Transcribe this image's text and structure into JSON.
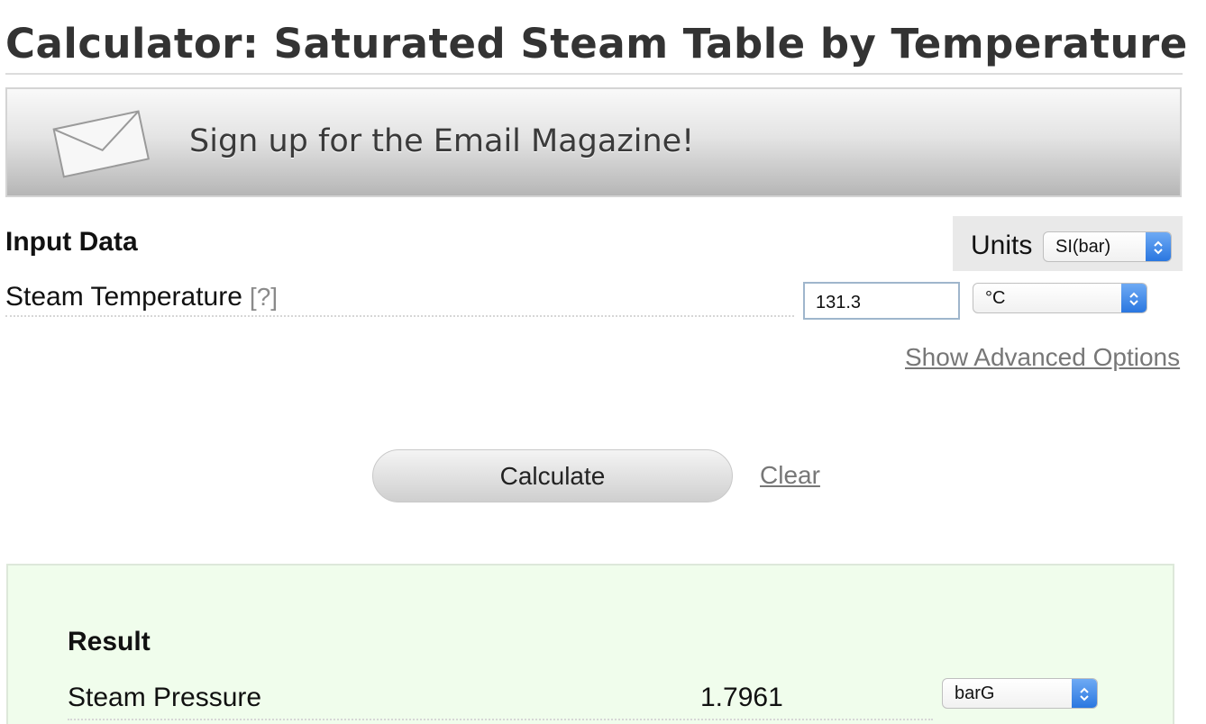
{
  "page": {
    "title": "Calculator: Saturated Steam Table by Temperature"
  },
  "banner": {
    "text": "Sign up for the Email Magazine!",
    "icon": "envelope-icon"
  },
  "input": {
    "section_title": "Input Data",
    "units_label": "Units",
    "units_value": "SI(bar)",
    "temperature_label": "Steam Temperature",
    "help_text": "[?]",
    "temperature_value": "131.3",
    "temperature_unit": "°C",
    "advanced_link": "Show Advanced Options"
  },
  "actions": {
    "calculate_label": "Calculate",
    "clear_label": "Clear"
  },
  "result": {
    "section_title": "Result",
    "pressure_label": "Steam Pressure",
    "pressure_value": "1.7961",
    "pressure_unit": "barG"
  },
  "colors": {
    "result_background": "#f0fdec",
    "select_accent": "#2a77e0",
    "link": "#777777"
  }
}
